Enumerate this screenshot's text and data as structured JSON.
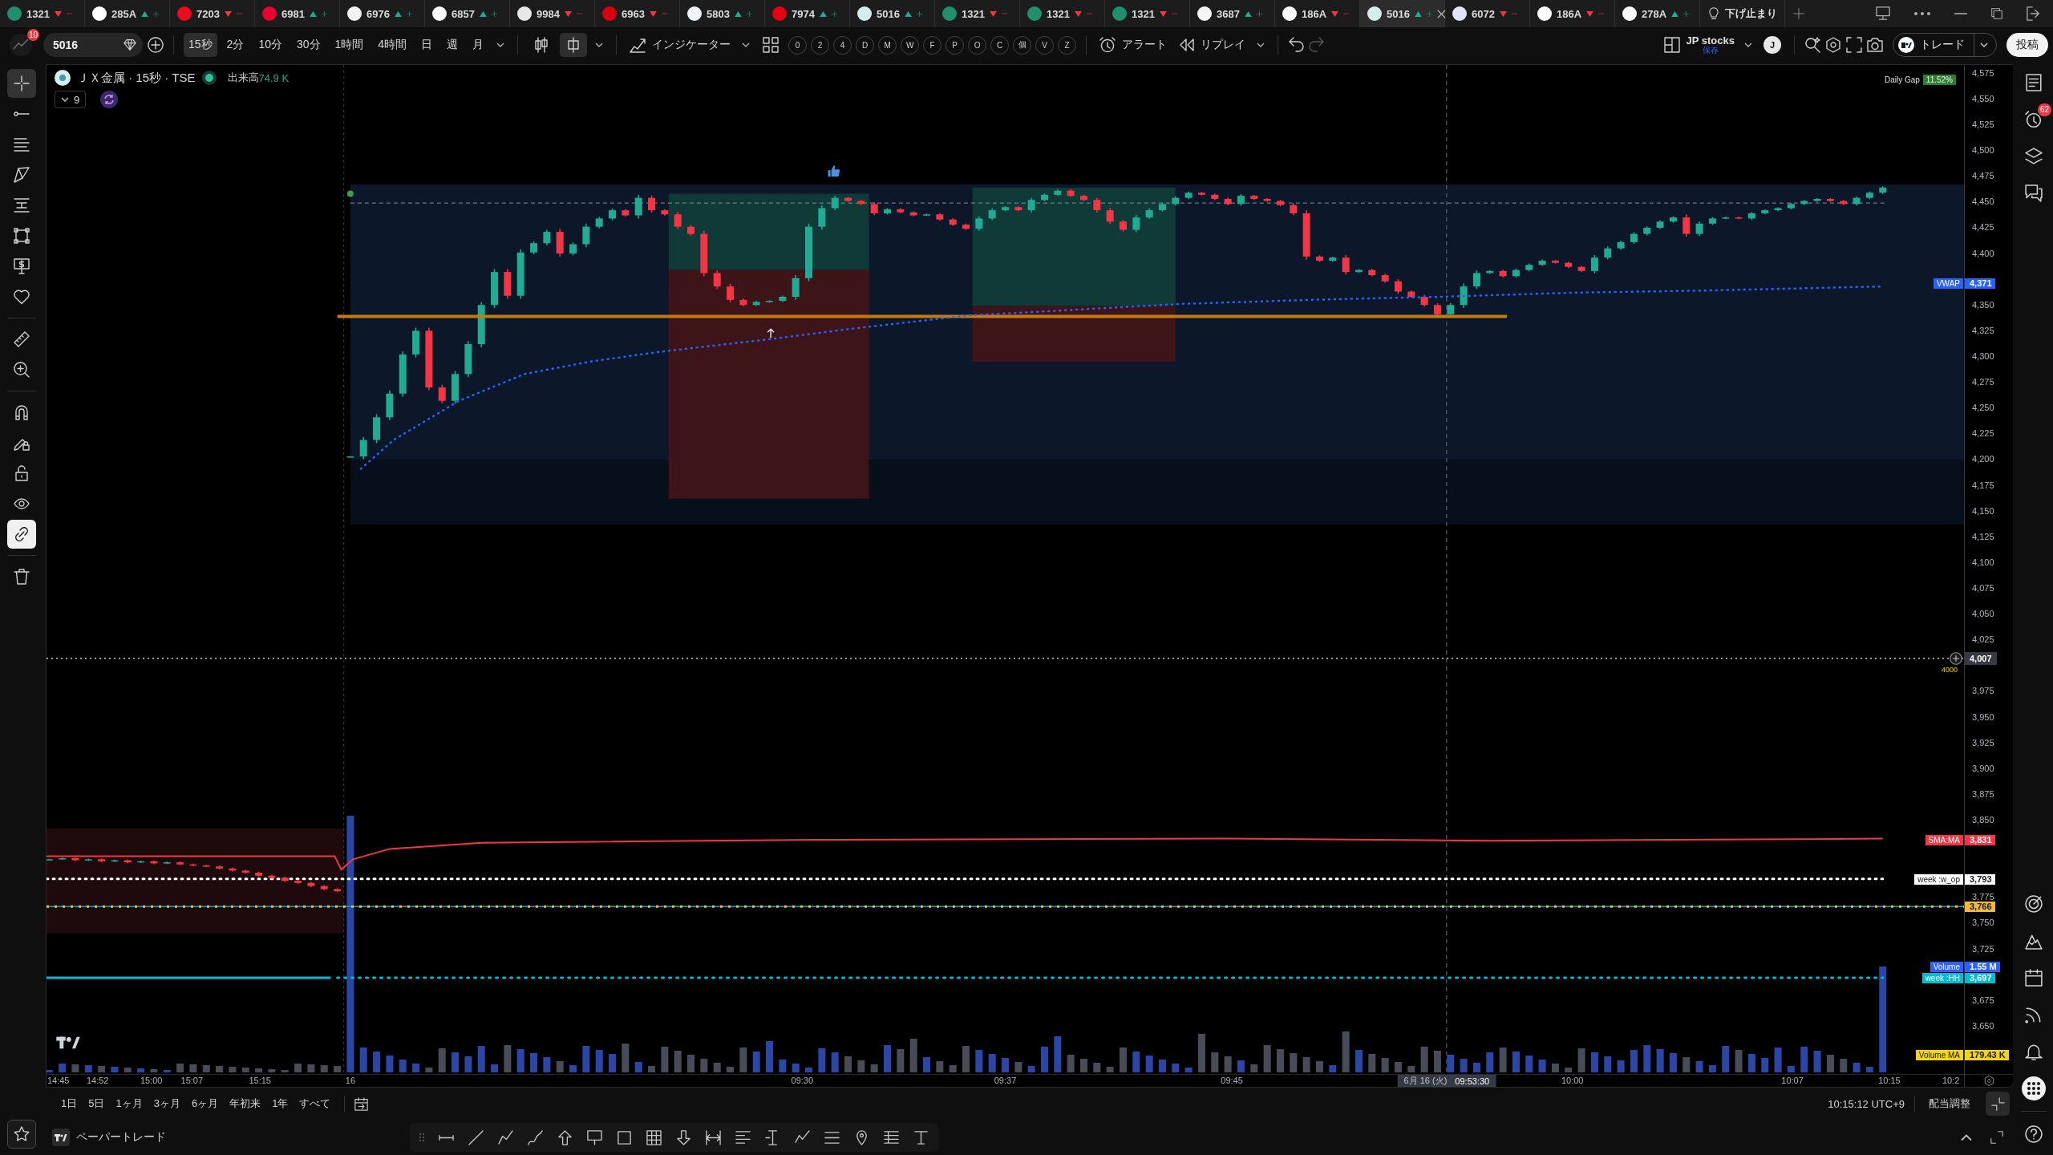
{
  "tabs": [
    {
      "kind": "symbol",
      "label": "1321",
      "rising": false,
      "color": "#1f8f6d",
      "selected": false
    },
    {
      "kind": "symbol",
      "label": "285A",
      "rising": true,
      "color": "#ffffff",
      "selected": false
    },
    {
      "kind": "symbol",
      "label": "7203",
      "rising": false,
      "color": "#eb0a1e",
      "selected": false
    },
    {
      "kind": "symbol",
      "label": "6981",
      "rising": true,
      "color": "#e60033",
      "selected": false
    },
    {
      "kind": "symbol",
      "label": "6976",
      "rising": true,
      "color": "#f2f2f2",
      "selected": false
    },
    {
      "kind": "symbol",
      "label": "6857",
      "rising": true,
      "color": "#fafafa",
      "selected": false
    },
    {
      "kind": "symbol",
      "label": "9984",
      "rising": false,
      "color": "#e8e8e8",
      "selected": false
    },
    {
      "kind": "symbol",
      "label": "6963",
      "rising": false,
      "color": "#d7000f",
      "selected": false
    },
    {
      "kind": "symbol",
      "label": "5803",
      "rising": true,
      "color": "#f0f4fa",
      "selected": false
    },
    {
      "kind": "symbol",
      "label": "7974",
      "rising": true,
      "color": "#e4000f",
      "selected": false
    },
    {
      "kind": "symbol",
      "label": "5016",
      "rising": true,
      "color": "#d6ecec",
      "selected": false
    },
    {
      "kind": "symbol",
      "label": "1321",
      "rising": false,
      "color": "#1f8f6d",
      "selected": false
    },
    {
      "kind": "symbol",
      "label": "1321",
      "rising": false,
      "color": "#1f8f6d",
      "selected": false
    },
    {
      "kind": "symbol",
      "label": "1321",
      "rising": false,
      "color": "#1f8f6d",
      "selected": false
    },
    {
      "kind": "symbol",
      "label": "3687",
      "rising": true,
      "color": "#f5f5f5",
      "selected": false
    },
    {
      "kind": "symbol",
      "label": "186A",
      "rising": false,
      "color": "#ffffff",
      "selected": false
    },
    {
      "kind": "symbol",
      "label": "5016",
      "rising": true,
      "color": "#d6ecec",
      "selected": true
    },
    {
      "kind": "symbol",
      "label": "6072",
      "rising": false,
      "color": "#dfe6f7",
      "selected": false
    },
    {
      "kind": "symbol",
      "label": "186A",
      "rising": false,
      "color": "#ffffff",
      "selected": false
    },
    {
      "kind": "symbol",
      "label": "278A",
      "rising": true,
      "color": "#ffffff",
      "selected": false
    },
    {
      "kind": "note",
      "label": "下げ止まり",
      "selected": false
    }
  ],
  "toolbar": {
    "avatar_badge": "10",
    "symbol": "5016",
    "intervals": [
      {
        "label": "15秒",
        "selected": true
      },
      {
        "label": "2分",
        "selected": false
      },
      {
        "label": "10分",
        "selected": false
      },
      {
        "label": "30分",
        "selected": false
      },
      {
        "label": "1時間",
        "selected": false
      },
      {
        "label": "4時間",
        "selected": false
      },
      {
        "label": "日",
        "selected": false
      },
      {
        "label": "週",
        "selected": false
      },
      {
        "label": "月",
        "selected": false
      }
    ],
    "chart_types": [
      {
        "selected": false
      },
      {
        "selected": true
      }
    ],
    "indicators": "インジケーター",
    "quick_keys": [
      "0",
      "2",
      "4",
      "D",
      "M",
      "W",
      "F",
      "P",
      "O",
      "C",
      "個",
      "V",
      "Z"
    ],
    "alert": "アラート",
    "replay": "リプレイ",
    "layout_name": "JP stocks",
    "layout_status": "保存",
    "user_initial": "J",
    "trade": "トレード",
    "publish": "投稿"
  },
  "left_toolbar": {
    "tools": [
      {
        "selected": true
      },
      {
        "selected": false
      },
      {
        "selected": false
      },
      {
        "selected": false
      },
      {
        "selected": false
      },
      {
        "selected": false
      },
      {
        "selected": false
      },
      {
        "selected": false
      },
      {
        "selected": false
      },
      {
        "selected": false
      }
    ],
    "toggles": [
      {
        "on": false
      },
      {
        "on": false
      },
      {
        "on": false
      },
      {
        "on": false
      },
      {
        "on": true
      }
    ]
  },
  "chart": {
    "legend": {
      "title": "ＪＸ金属 · 15秒 · TSE",
      "volume_label": "出来高",
      "volume_value": "74.9 K",
      "indicators_count": "9"
    },
    "daily_gap": {
      "label": "Daily Gap",
      "value": "11.52%"
    },
    "crosshair": {
      "date": "6月 16 (火)",
      "time": "09:53:30",
      "price": "4,007",
      "note": "4000"
    }
  },
  "price_axis": {
    "ticks": [
      "4,575",
      "4,550",
      "4,525",
      "4,500",
      "4,475",
      "4,450",
      "4,425",
      "4,400",
      "4,350",
      "4,325",
      "4,300",
      "4,275",
      "4,250",
      "4,225",
      "4,200",
      "4,175",
      "4,150",
      "4,125",
      "4,100",
      "4,075",
      "4,050",
      "4,025",
      "3,975",
      "3,950",
      "3,925",
      "3,900",
      "3,875",
      "3,850",
      "3,775",
      "3,750",
      "3,725",
      "3,675",
      "3,650"
    ],
    "labels": [
      {
        "name": "VWAP",
        "value": "4,371",
        "color": "#2962ff"
      },
      {
        "name": "SMA:MA",
        "value": "3,831",
        "color": "#f23645"
      },
      {
        "name": "week :w_op",
        "value": "3,793",
        "color": "#ffffff"
      },
      {
        "value": "3,766",
        "color": "#f5b73b"
      },
      {
        "name": "Volume",
        "value": "1.55 M",
        "color": "#2962ff"
      },
      {
        "name": "week :HH",
        "value": "3,697",
        "color": "#00bcd4"
      },
      {
        "name": "Volume MA",
        "value": "179.43 K",
        "color": "#f5d50d"
      }
    ]
  },
  "time_axis": {
    "ticks": [
      "14:45",
      "14:52",
      "15:00",
      "15:07",
      "15:15",
      "16",
      "09:30",
      "09:37",
      "09:45",
      "10:00",
      "10:07",
      "10:15",
      "10:2"
    ]
  },
  "right_sidebar": {
    "alerts_badge": "62"
  },
  "range_bar": {
    "ranges": [
      "1日",
      "5日",
      "1ヶ月",
      "3ヶ月",
      "6ヶ月",
      "年初来",
      "1年",
      "すべて"
    ],
    "clock": "10:15:12 UTC+9",
    "adjust": "配当調整"
  },
  "bottom_panel": {
    "title": "ペーパートレード"
  }
}
